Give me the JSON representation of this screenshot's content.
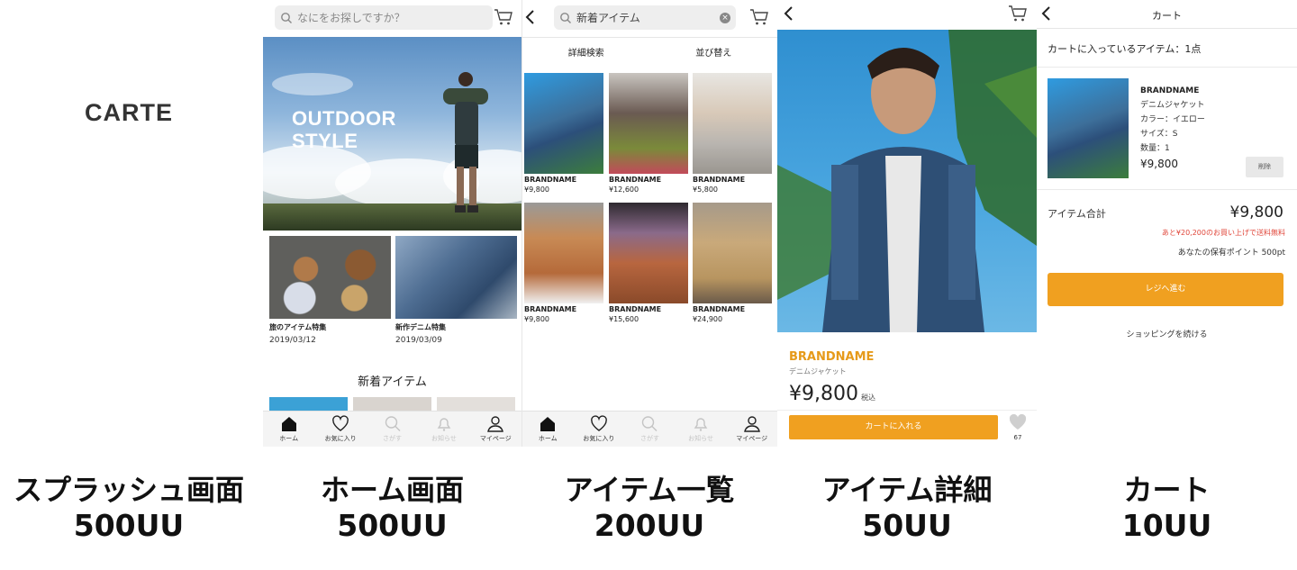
{
  "splash": {
    "logo": "CARTE",
    "caption": "スプラッシュ画面",
    "uu": "500UU"
  },
  "home": {
    "search_placeholder": "なにをお探しですか？",
    "hero_text_line1": "OUTDOOR",
    "hero_text_line2": "STYLE",
    "features": [
      {
        "title": "旅のアイテム特集",
        "date": "2019/03/12"
      },
      {
        "title": "新作デニム特集",
        "date": "2019/03/09"
      }
    ],
    "section_title": "新着アイテム",
    "caption": "ホーム画面",
    "uu": "500UU"
  },
  "tabs": [
    {
      "label": "ホーム",
      "icon": "home-icon"
    },
    {
      "label": "お気に入り",
      "icon": "heart-icon"
    },
    {
      "label": "さがす",
      "icon": "search-icon"
    },
    {
      "label": "お知らせ",
      "icon": "bell-icon"
    },
    {
      "label": "マイページ",
      "icon": "user-icon"
    }
  ],
  "list": {
    "search_value": "新着アイテム",
    "filter_label": "詳細検索",
    "sort_label": "並び替え",
    "items": [
      {
        "brand": "BRANDNAME",
        "price": "¥9,800"
      },
      {
        "brand": "BRANDNAME",
        "price": "¥12,600"
      },
      {
        "brand": "BRANDNAME",
        "price": "¥5,800"
      },
      {
        "brand": "BRANDNAME",
        "price": "¥9,800"
      },
      {
        "brand": "BRANDNAME",
        "price": "¥15,600"
      },
      {
        "brand": "BRANDNAME",
        "price": "¥24,900"
      }
    ],
    "caption": "アイテム一覧",
    "uu": "200UU"
  },
  "detail": {
    "brand": "BRANDNAME",
    "name": "デニムジャケット",
    "price": "¥9,800",
    "tax_label": "税込",
    "add_to_cart": "カートに入れる",
    "favorite_count": "67",
    "caption": "アイテム詳細",
    "uu": "50UU"
  },
  "cart": {
    "title": "カート",
    "count_text": "カートに入っているアイテム：1点",
    "item": {
      "brand": "BRANDNAME",
      "name": "デニムジャケット",
      "color": "カラー：イエロー",
      "size": "サイズ：S",
      "qty": "数量：1",
      "price": "¥9,800"
    },
    "delete_label": "削除",
    "total_label": "アイテム合計",
    "total_value": "¥9,800",
    "free_shipping_note": "あと¥20,200のお買い上げで送料無料",
    "points_note": "あなたの保有ポイント 500pt",
    "checkout_label": "レジへ進む",
    "continue_label": "ショッピングを続ける",
    "caption": "カート",
    "uu": "10UU"
  },
  "colors": {
    "accent_orange": "#f0a020",
    "brand_orange_text": "#e69a1a",
    "alert_red": "#e0463a"
  }
}
